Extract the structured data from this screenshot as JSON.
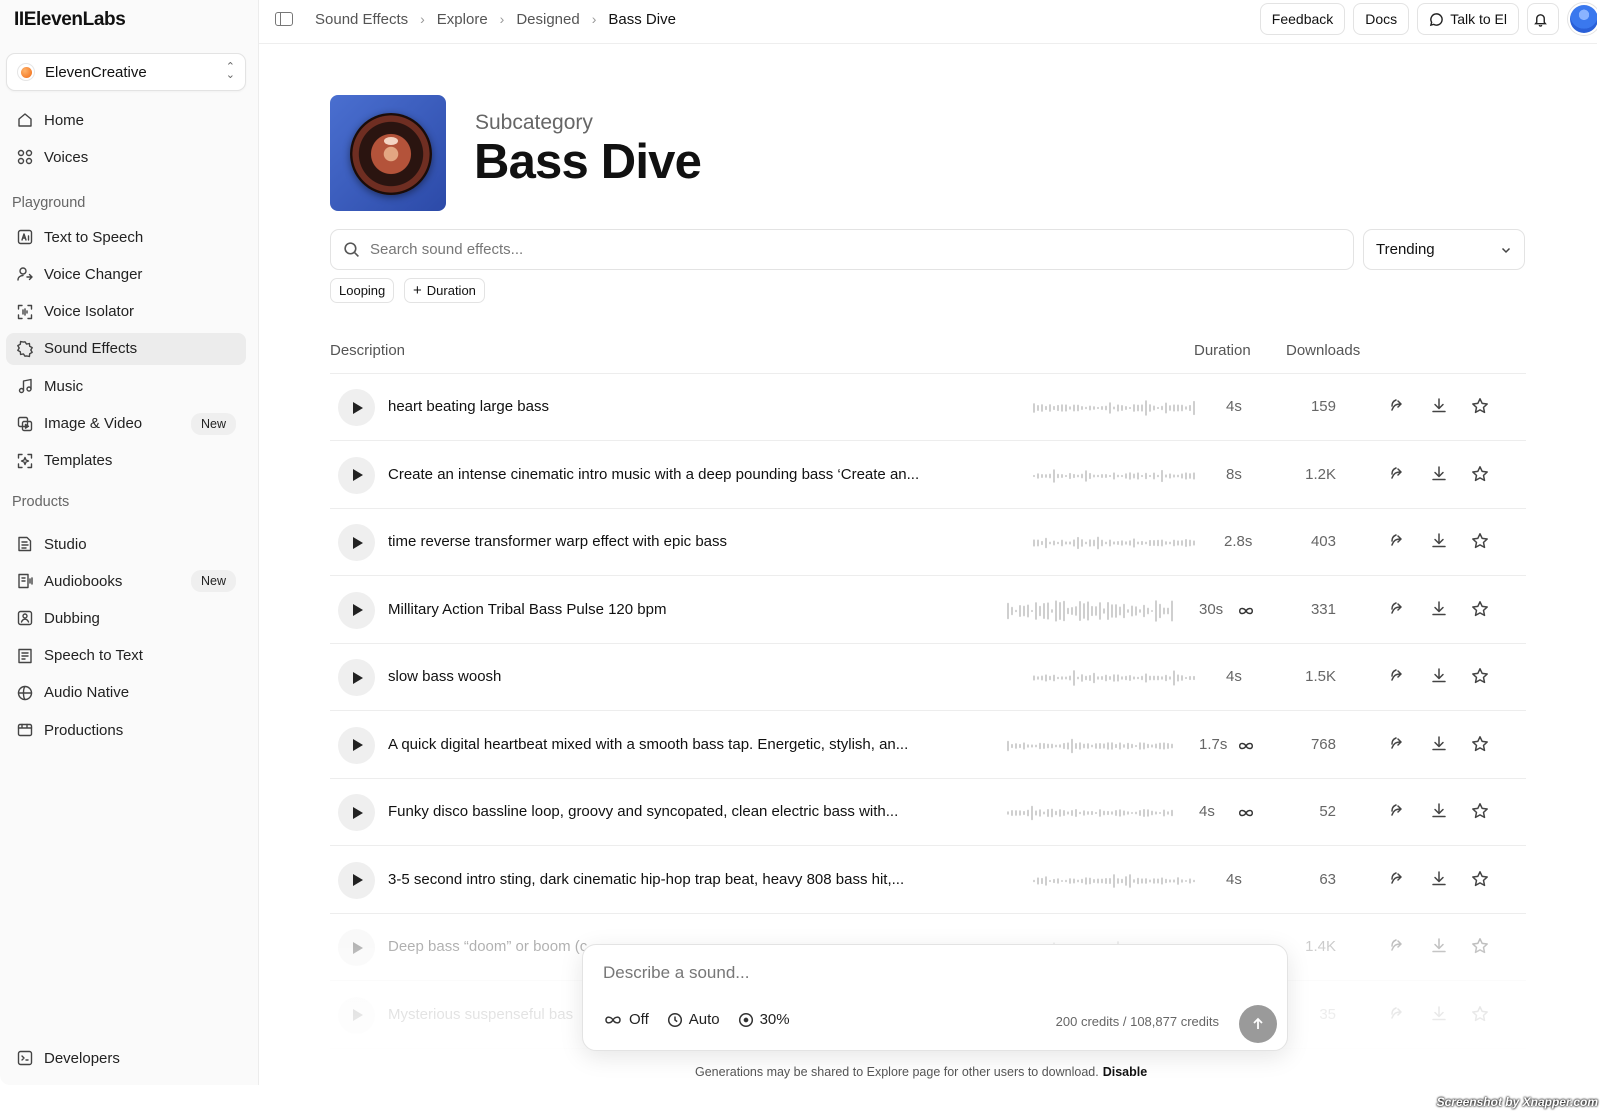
{
  "app": {
    "logo": "IIElevenLabs",
    "workspace": "ElevenCreative"
  },
  "sidebar": {
    "top": [
      {
        "label": "Home",
        "icon": "home-icon"
      },
      {
        "label": "Voices",
        "icon": "voices-icon"
      }
    ],
    "playground_title": "Playground",
    "playground": [
      {
        "label": "Text to Speech",
        "icon": "text-to-speech-icon"
      },
      {
        "label": "Voice Changer",
        "icon": "voice-changer-icon"
      },
      {
        "label": "Voice Isolator",
        "icon": "voice-isolator-icon"
      },
      {
        "label": "Sound Effects",
        "icon": "sound-effects-icon",
        "active": true
      },
      {
        "label": "Music",
        "icon": "music-icon"
      },
      {
        "label": "Image & Video",
        "icon": "image-video-icon",
        "badge": "New"
      },
      {
        "label": "Templates",
        "icon": "templates-icon"
      }
    ],
    "products_title": "Products",
    "products": [
      {
        "label": "Studio",
        "icon": "studio-icon"
      },
      {
        "label": "Audiobooks",
        "icon": "audiobooks-icon",
        "badge": "New"
      },
      {
        "label": "Dubbing",
        "icon": "dubbing-icon"
      },
      {
        "label": "Speech to Text",
        "icon": "speech-to-text-icon"
      },
      {
        "label": "Audio Native",
        "icon": "audio-native-icon"
      },
      {
        "label": "Productions",
        "icon": "productions-icon"
      }
    ],
    "bottom": {
      "label": "Developers",
      "icon": "developers-icon"
    }
  },
  "topbar": {
    "breadcrumbs": [
      "Sound Effects",
      "Explore",
      "Designed",
      "Bass Dive"
    ],
    "feedback": "Feedback",
    "docs": "Docs",
    "talk": "Talk to El"
  },
  "header": {
    "subtitle": "Subcategory",
    "title": "Bass Dive"
  },
  "search": {
    "placeholder": "Search sound effects...",
    "value": ""
  },
  "sort": {
    "selected": "Trending"
  },
  "filters": {
    "looping": "Looping",
    "duration": "Duration"
  },
  "table": {
    "columns": {
      "description": "Description",
      "duration": "Duration",
      "downloads": "Downloads"
    },
    "rows": [
      {
        "description": "heart beating large bass",
        "duration": "4s",
        "looping": false,
        "downloads": "159"
      },
      {
        "description": "Create an intense cinematic intro music with a deep pounding bass ‘Create an...",
        "duration": "8s",
        "looping": false,
        "downloads": "1.2K"
      },
      {
        "description": "time reverse transformer warp effect with epic bass",
        "duration": "2.8s",
        "looping": false,
        "downloads": "403"
      },
      {
        "description": "Millitary Action Tribal Bass Pulse 120 bpm",
        "duration": "30s",
        "looping": true,
        "downloads": "331"
      },
      {
        "description": "slow bass woosh",
        "duration": "4s",
        "looping": false,
        "downloads": "1.5K"
      },
      {
        "description": "A quick digital heartbeat mixed with a smooth bass tap. Energetic, stylish, an...",
        "duration": "1.7s",
        "looping": true,
        "downloads": "768"
      },
      {
        "description": "Funky disco bassline loop, groovy and syncopated, clean electric bass with...",
        "duration": "4s",
        "looping": true,
        "downloads": "52"
      },
      {
        "description": "3-5 second intro sting, dark cinematic hip-hop trap beat, heavy 808 bass hit,...",
        "duration": "4s",
        "looping": false,
        "downloads": "63"
      },
      {
        "description": "Deep bass “doom” or boom (c",
        "duration": "",
        "looping": false,
        "downloads": "1.4K"
      },
      {
        "description": "Mysterious suspenseful bas",
        "duration": "",
        "looping": false,
        "downloads": "35"
      }
    ]
  },
  "prompt": {
    "placeholder": "Describe a sound...",
    "loop": "Off",
    "duration": "Auto",
    "influence": "30%",
    "credits": "200 credits / 108,877 credits"
  },
  "notice": {
    "text": "Generations may be shared to Explore page for other users to download.",
    "link": "Disable"
  },
  "watermark": "Screenshot by Xnapper.com"
}
